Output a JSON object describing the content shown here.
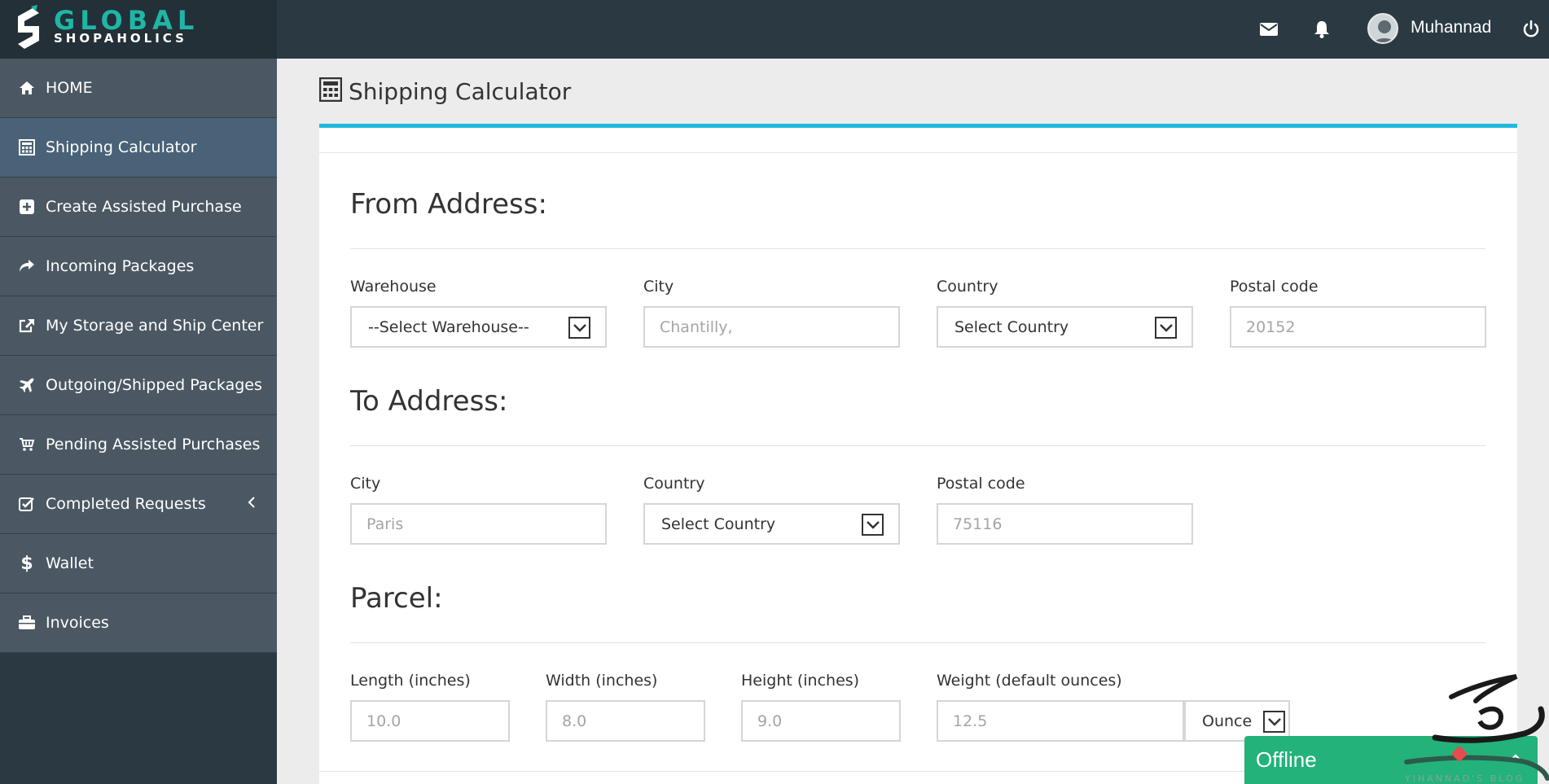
{
  "brand": {
    "line1": "GLOBAL",
    "line2": "SHOPAHOLICS"
  },
  "header": {
    "icons": [
      "envelope-icon",
      "bell-icon",
      "power-icon"
    ],
    "username": "Muhannad"
  },
  "sidebar": {
    "items": [
      {
        "label": "HOME",
        "icon": "home-icon",
        "active": false
      },
      {
        "label": "Shipping Calculator",
        "icon": "calculator-icon",
        "active": true
      },
      {
        "label": "Create Assisted Purchase",
        "icon": "plus-square-icon",
        "active": false
      },
      {
        "label": "Incoming Packages",
        "icon": "share-arrow-icon",
        "active": false
      },
      {
        "label": "My Storage and Ship Center",
        "icon": "external-box-icon",
        "active": false
      },
      {
        "label": "Outgoing/Shipped Packages",
        "icon": "plane-icon",
        "active": false
      },
      {
        "label": "Pending Assisted Purchases",
        "icon": "cart-icon",
        "active": false
      },
      {
        "label": "Completed Requests",
        "icon": "check-square-icon",
        "active": false,
        "has_submenu": true
      },
      {
        "label": "Wallet",
        "icon": "dollar-icon",
        "active": false
      },
      {
        "label": "Invoices",
        "icon": "briefcase-icon",
        "active": false
      }
    ]
  },
  "page": {
    "title": "Shipping Calculator"
  },
  "from": {
    "title": "From Address:",
    "warehouse_label": "Warehouse",
    "warehouse_value": "--Select Warehouse--",
    "city_label": "City",
    "city_placeholder": "Chantilly,",
    "country_label": "Country",
    "country_value": "Select Country",
    "postal_label": "Postal code",
    "postal_placeholder": "20152"
  },
  "to": {
    "title": "To Address:",
    "city_label": "City",
    "city_placeholder": "Paris",
    "country_label": "Country",
    "country_value": "Select Country",
    "postal_label": "Postal code",
    "postal_placeholder": "75116"
  },
  "parcel": {
    "title": "Parcel:",
    "length_label": "Length (inches)",
    "length_placeholder": "10.0",
    "width_label": "Width (inches)",
    "width_placeholder": "8.0",
    "height_label": "Height (inches)",
    "height_placeholder": "9.0",
    "weight_label": "Weight (default ounces)",
    "weight_placeholder": "12.5",
    "unit_value": "Ounce"
  },
  "chat": {
    "status": "Offline"
  },
  "watermark": {
    "text": "YIHANNAD'S BLOG"
  },
  "colors": {
    "accent": "#1fb8de",
    "brand": "#1fb6a6",
    "sidebar": "#4b5863",
    "active": "#4a6277",
    "chat": "#23b27a"
  }
}
